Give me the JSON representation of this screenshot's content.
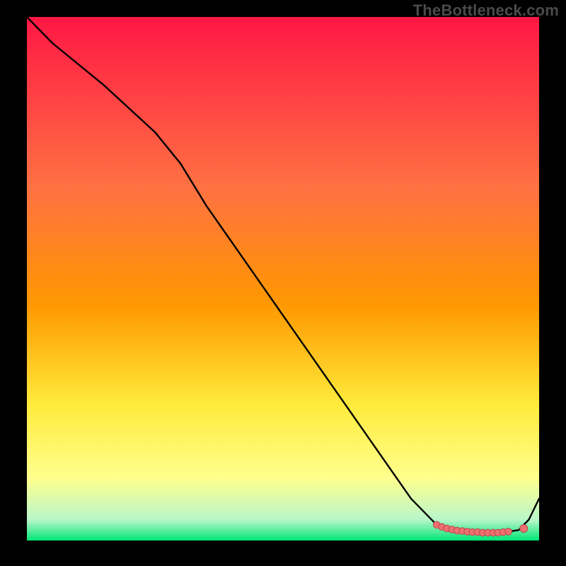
{
  "watermark": "TheBottleneck.com",
  "colors": {
    "background_black": "#000000",
    "gradient_top": "#ff1744",
    "gradient_upper_mid": "#ff9800",
    "gradient_mid": "#ffeb3b",
    "gradient_lower_yellow": "#ffff8d",
    "gradient_green": "#00e676",
    "line": "#000000",
    "marker_fill": "#ef7070",
    "marker_stroke": "#b94b4b",
    "watermark_text": "#4a4a4a"
  },
  "chart_data": {
    "type": "line",
    "title": "",
    "xlabel": "",
    "ylabel": "",
    "xlim": [
      0,
      100
    ],
    "ylim": [
      0,
      100
    ],
    "series": [
      {
        "name": "curve",
        "x": [
          0,
          5,
          15,
          25,
          30,
          35,
          45,
          55,
          65,
          75,
          80,
          82,
          85,
          88,
          90,
          92,
          94,
          96,
          98,
          100
        ],
        "y": [
          100,
          95,
          87,
          78,
          72,
          64,
          50,
          36,
          22,
          8,
          3,
          2,
          1.8,
          1.6,
          1.5,
          1.5,
          1.7,
          2,
          4,
          8
        ]
      }
    ],
    "markers": {
      "name": "highlight-band",
      "points": [
        {
          "x": 80,
          "y": 3.0
        },
        {
          "x": 81,
          "y": 2.6
        },
        {
          "x": 82,
          "y": 2.3
        },
        {
          "x": 83,
          "y": 2.1
        },
        {
          "x": 84,
          "y": 1.9
        },
        {
          "x": 85,
          "y": 1.8
        },
        {
          "x": 86,
          "y": 1.7
        },
        {
          "x": 87,
          "y": 1.6
        },
        {
          "x": 88,
          "y": 1.6
        },
        {
          "x": 89,
          "y": 1.5
        },
        {
          "x": 90,
          "y": 1.5
        },
        {
          "x": 91,
          "y": 1.5
        },
        {
          "x": 92,
          "y": 1.5
        },
        {
          "x": 93,
          "y": 1.6
        },
        {
          "x": 94,
          "y": 1.7
        }
      ],
      "isolated_point": {
        "x": 97,
        "y": 2.3
      }
    }
  }
}
